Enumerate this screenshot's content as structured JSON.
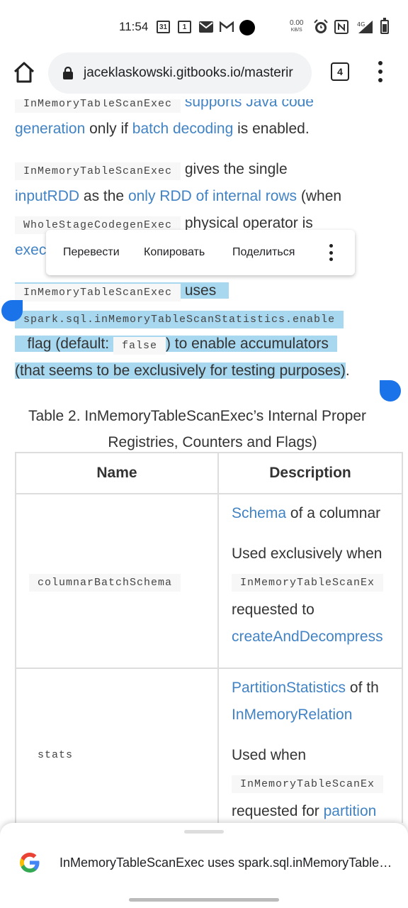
{
  "status": {
    "time": "11:54",
    "calendar_day": "31",
    "badge_one": "1",
    "net_speed": "0.00",
    "net_unit": "KB/S",
    "network": "4G"
  },
  "browser": {
    "url": "jaceklaskowski.gitbooks.io/masterir",
    "tab_count": "4"
  },
  "article": {
    "line1_code": "InMemoryTableScanExec",
    "line1_link": "supports Java code",
    "line2_link1": "generation",
    "line2_text1": "only if",
    "line2_link2": "batch decoding",
    "line2_text2": "is enabled.",
    "p2_code": "InMemoryTableScanExec",
    "p2_text": "gives the single",
    "p2_link1": "inputRDD",
    "p2_text2": "as the",
    "p2_link2": "only RDD of internal rows",
    "p2_text3": "(when",
    "p2_code2": "WholeStageCodegenExec",
    "p2_text4": "physical operator is",
    "p2_link3": "exec",
    "p3_code": "InMemoryTableScanExec",
    "p3_text": "uses",
    "p3_code2": "spark.sql.inMemoryTableScanStatistics.enable",
    "p3_text2": "flag (default:",
    "p3_code3": "false",
    "p3_text3": ") to enable accumulators",
    "p3_text4": "(that seems to be exclusively for testing purposes)",
    "p3_end": "."
  },
  "context_menu": {
    "translate": "Перевести",
    "copy": "Копировать",
    "share": "Поделиться"
  },
  "table": {
    "caption_line1": "Table 2. InMemoryTableScanExec’s Internal Proper",
    "caption_line2": "Registries, Counters and Flags)",
    "headers": [
      "Name",
      "Description"
    ],
    "rows": [
      {
        "name": "columnarBatchSchema",
        "desc_link": "Schema",
        "desc_text": "of a columnar",
        "desc_used": "Used exclusively when",
        "desc_code": "InMemoryTableScanEx",
        "desc_req": "requested to",
        "desc_link2": "createAndDecompress"
      },
      {
        "name": "stats",
        "desc_link": "PartitionStatistics",
        "desc_text": "of th",
        "desc_link2": "InMemoryRelation",
        "desc_used": "Used when",
        "desc_code": "InMemoryTableScanEx",
        "desc_req": "requested for",
        "desc_link3": "partition"
      }
    ]
  },
  "sheet": {
    "text": "InMemoryTableScanExec uses spark.sql.inMemoryTableScanStatistics.enabled"
  }
}
